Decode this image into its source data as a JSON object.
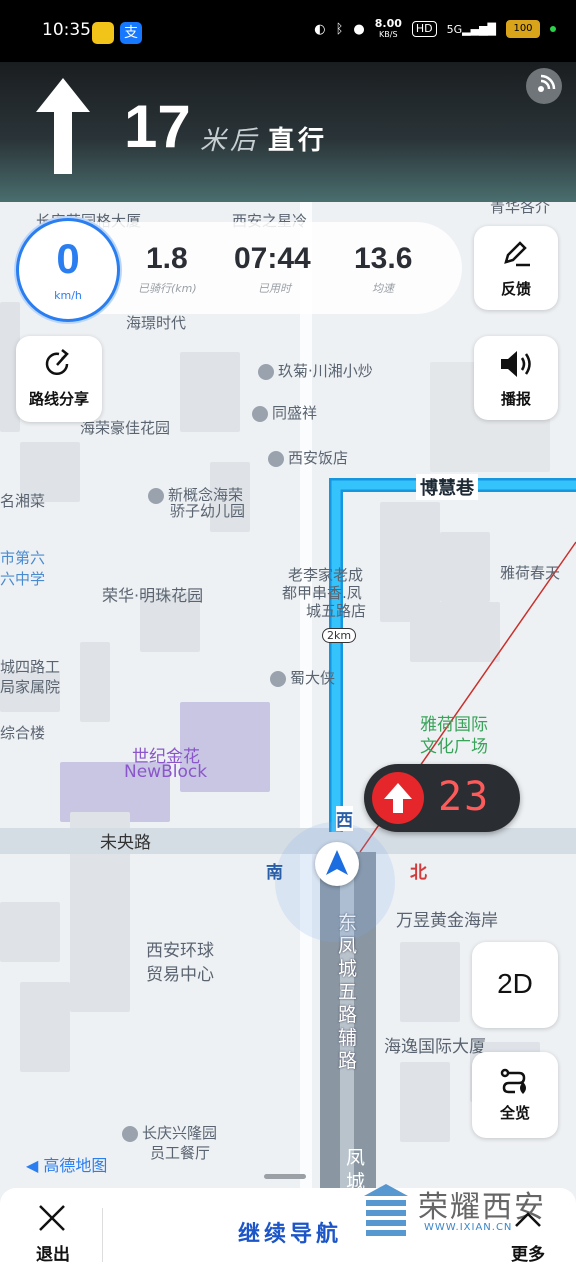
{
  "status_bar": {
    "time": "10:35",
    "net_speed": "8.00",
    "net_unit": "KB/S",
    "hd": "HD",
    "signal": "5G",
    "battery": "100"
  },
  "guidance": {
    "distance": "17",
    "unit": "米后",
    "action": "直行",
    "icon": "straight-arrow-icon"
  },
  "speedometer": {
    "value": "0",
    "unit": "km/h"
  },
  "stats": [
    {
      "value": "1.8",
      "label": "已骑行(km)"
    },
    {
      "value": "07:44",
      "label": "已用时"
    },
    {
      "value": "13.6",
      "label": "均速"
    }
  ],
  "buttons": {
    "feedback": "反馈",
    "broadcast": "播报",
    "share_route": "路线分享",
    "view_2d": "2D",
    "overview": "全览",
    "exit": "退出",
    "continue_nav": "继续导航",
    "more": "更多"
  },
  "traffic_light": {
    "countdown": "23",
    "color": "#e5262b"
  },
  "compass": {
    "south": "南",
    "north": "北",
    "west": "西"
  },
  "route": {
    "distance_marker": "2km",
    "color": "#2db7f5"
  },
  "map_labels": {
    "top_1": "长安花园格大厦",
    "top_2": "西安之星冷",
    "top_3": "青华各介",
    "haihuan": "海璟时代",
    "jiuju": "玖菊·川湘小炒",
    "tongshengxiang": "同盛祥",
    "xian_hotel": "西安饭店",
    "bohui": "博慧巷",
    "haorong": "海荣豪佳花园",
    "xiangcai": "名湘菜",
    "xingainian": "新概念海荣",
    "xingainian2": "骄子幼儿园",
    "shi_dier": "市第六",
    "zhongxue": "六中学",
    "ronghua": "荣华·明珠花园",
    "laoli": "老李家老成",
    "laoli2": "都甲串香.凤",
    "laoli3": "城五路店",
    "yahe": "雅荷春天",
    "chengsi": "城四路工",
    "chengsi2": "局家属院",
    "shudaxia": "蜀大侠",
    "yahe_plaza": "雅荷国际",
    "yahe_plaza2": "文化广场",
    "zonghe": "综合楼",
    "shiji": "世纪金花",
    "newblock": "NewBlock",
    "weiyang": "未央路",
    "wanyu": "万昱黄金海岸",
    "huanqiu": "西安环球",
    "huanqiu2": "贸易中心",
    "fengcheng_road": "东凤城五路辅路",
    "haiyi": "海逸国际大厦",
    "changqing": "长庆兴隆园",
    "changqing2": "员工餐厅",
    "feng": "凤城",
    "gaode": "高德地图",
    "watermark": "荣耀西安",
    "watermark_url": "WWW.IXIAN.CN"
  }
}
